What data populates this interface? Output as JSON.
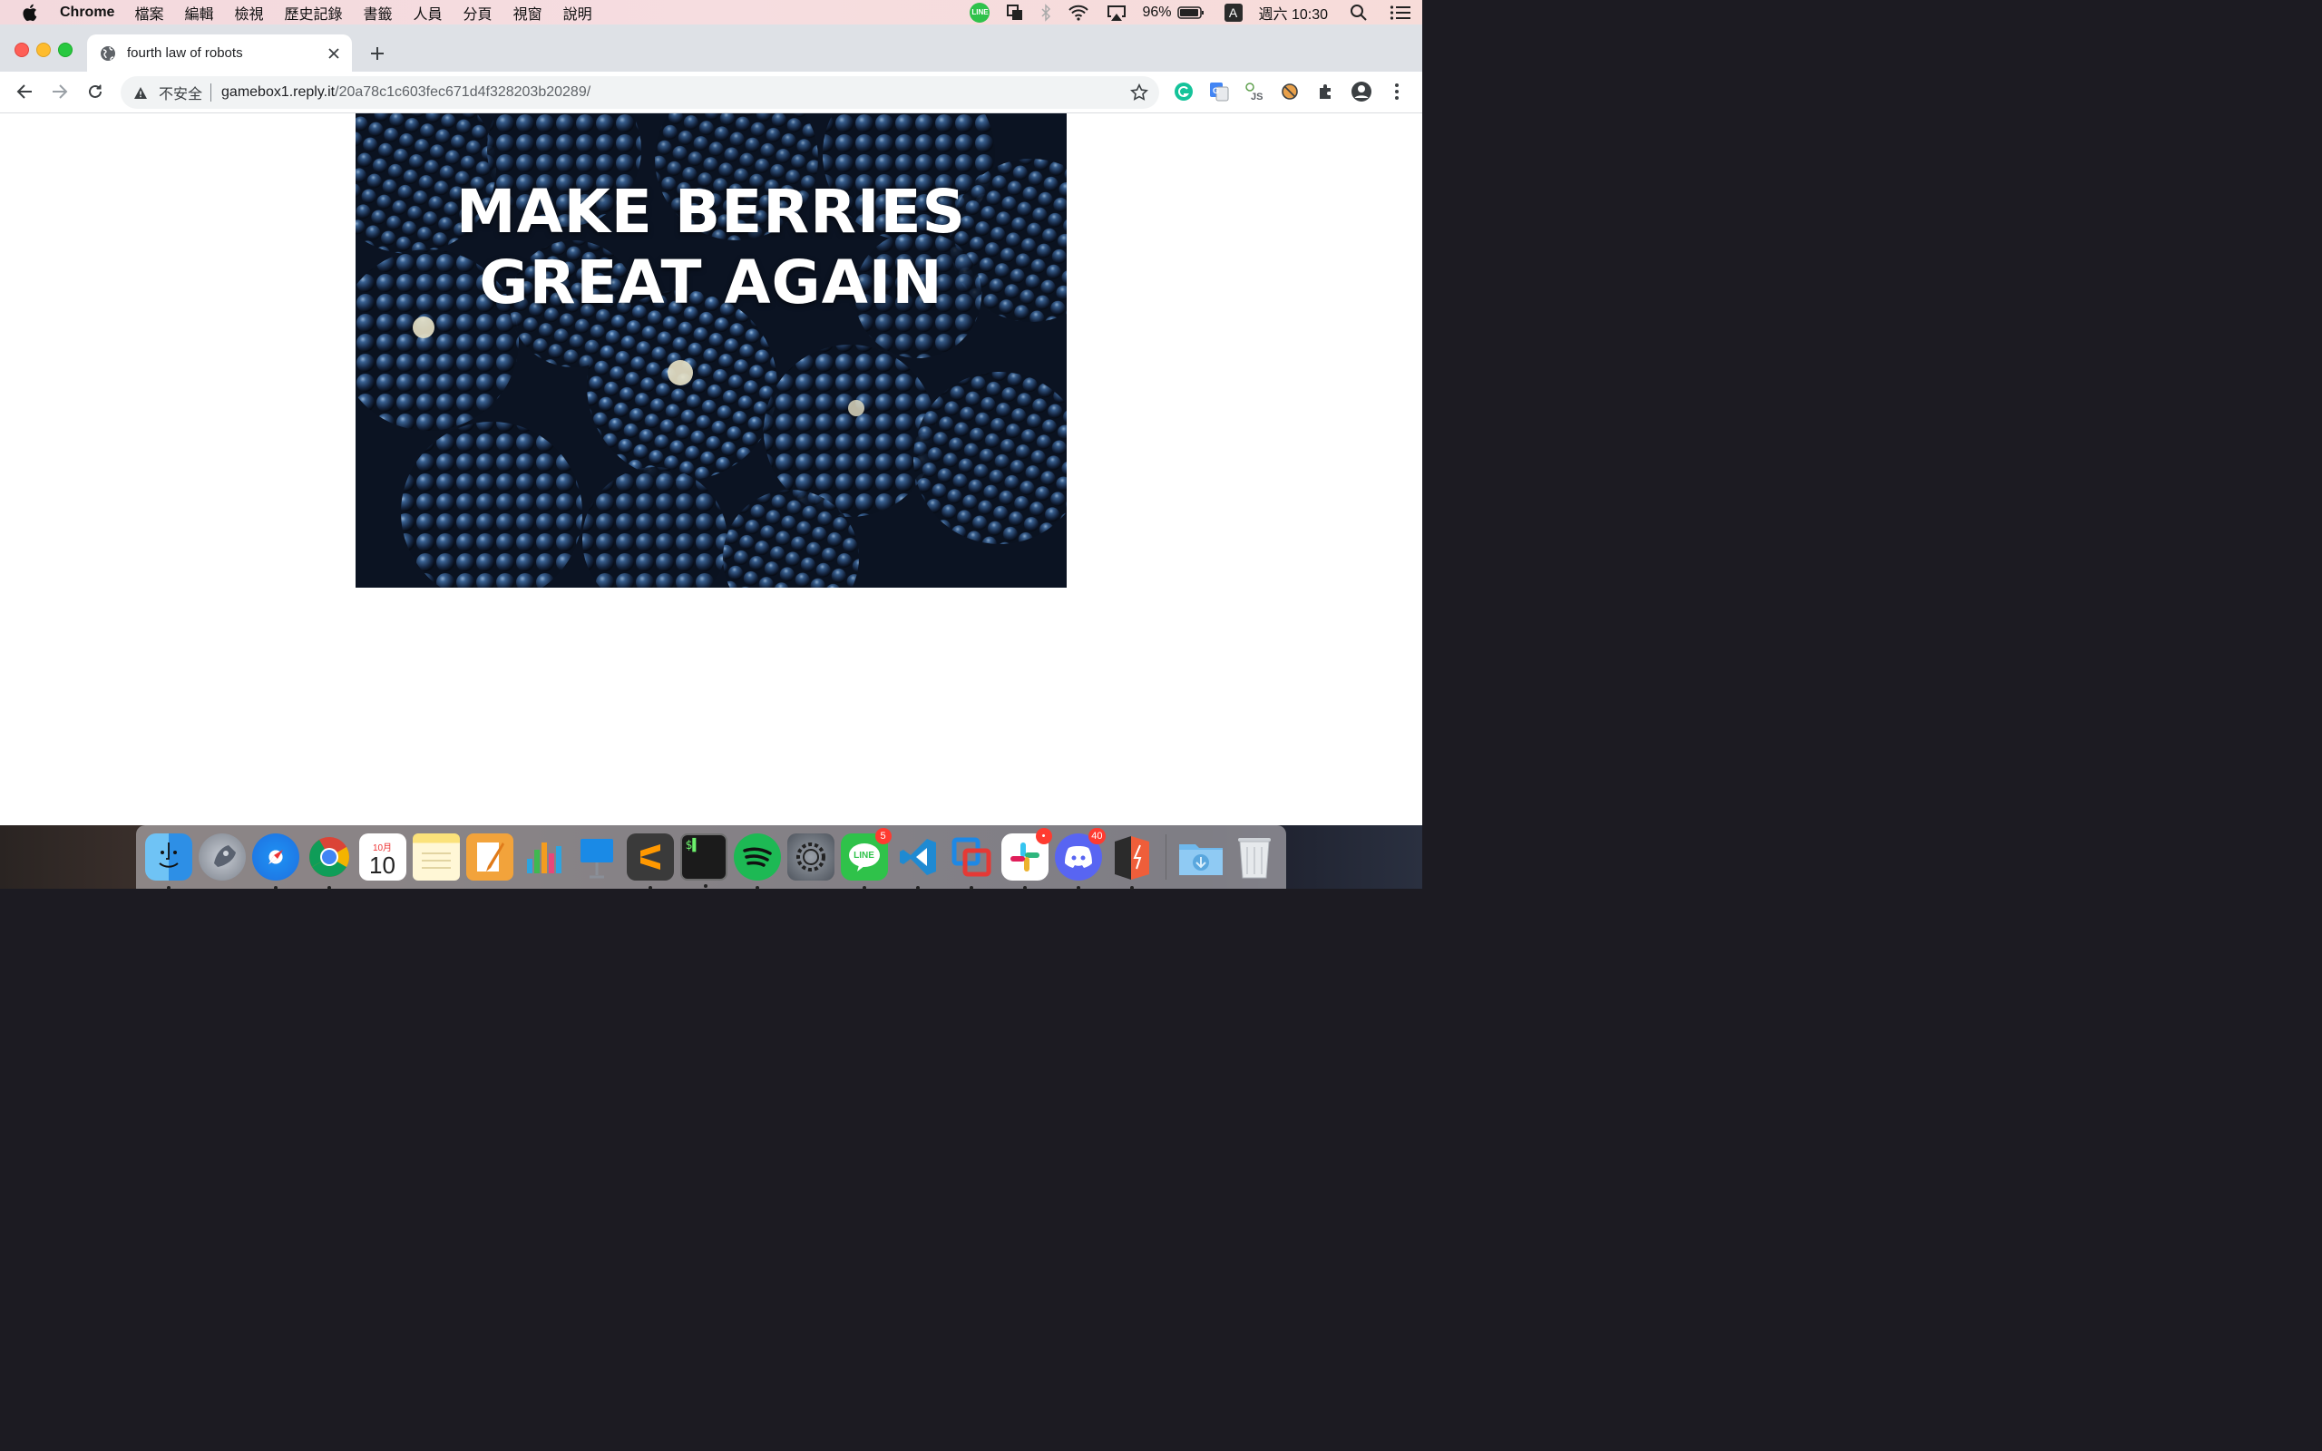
{
  "menubar": {
    "app_name": "Chrome",
    "menus": [
      "檔案",
      "編輯",
      "檢視",
      "歷史記錄",
      "書籤",
      "人員",
      "分頁",
      "視窗",
      "說明"
    ],
    "line_label": "LINE",
    "battery": "96%",
    "input_method": "A",
    "clock": "週六 10:30"
  },
  "tab": {
    "title": "fourth law of robots"
  },
  "omnibox": {
    "security_label": "不安全",
    "url_host": "gamebox1.reply.it",
    "url_path": "/20a78c1c603fec671d4f328203b20289/"
  },
  "page": {
    "headline_line1": "MAKE BERRIES",
    "headline_line2": "GREAT AGAIN"
  },
  "dock": {
    "calendar_month": "10月",
    "calendar_day": "10",
    "line_badge": "5",
    "discord_badge": "40",
    "slack_badge": "•",
    "line_label": "LINE"
  },
  "colors": {
    "tabstrip": "#dee1e6",
    "omnibox": "#f1f3f4",
    "menubar": "#f6dde0"
  }
}
